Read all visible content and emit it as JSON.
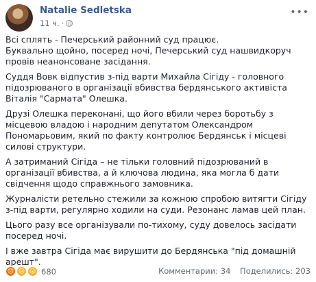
{
  "author": {
    "name": "Natalie Sedletska",
    "time": "11 ч.",
    "separator": "·"
  },
  "post_text": [
    "Всі сплять - Печерський районний суд працює.\nБуквально щойно, посеред ночі, Печерський суд нашвидкоруч провів неанонсоване засідання.",
    "Суддя Вовк відпустив з-під варти Михайла Сігіду - головного підозрюваного в організації вбивства бердянського активіста Віталія \"Сармата\" Олешка.",
    "Друзі Олешка переконані, що його вбили через боротьбу з місцевою владою і народним депутатом Олександром Пономарьовим, який по факту контролює Бердянськ і місцеві силові структури.",
    "А затриманий Сігіда – не тільки головний підозрюваний в організації вбивства, а й ключова людина, яка могла б дати свідчення щодо справжнього замовника.",
    "Журналісти ретельно стежили за кожною спробою витягти Сігіду з-під варти, регулярно ходили на суди. Резонанс ламав цей план.",
    "Цього разу все організували по-тихому, суду довелось засідати посеред ночі.",
    "І вже завтра Сігіда має вирушити до Бердянська \"під домашній арешт\"."
  ],
  "reactions": {
    "icons": [
      "angry-icon",
      "sad-icon",
      "wow-icon"
    ],
    "count": "680"
  },
  "stats": {
    "comments": "Комментарии: 34",
    "shares": "Поделились: 203"
  }
}
